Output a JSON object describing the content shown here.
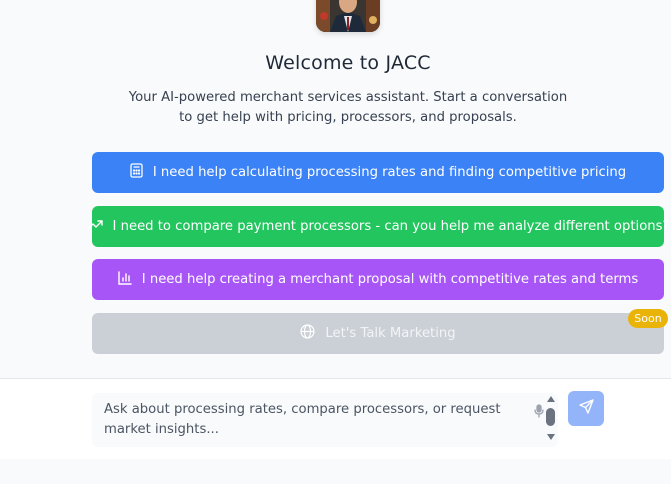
{
  "header": {
    "title": "Welcome to JACC",
    "subtitle": "Your AI-powered merchant services assistant. Start a conversation to get help with pricing, processors, and proposals."
  },
  "actions": [
    {
      "label": "I need help calculating processing rates and finding competitive pricing",
      "icon": "calculator-icon",
      "color": "#3b82f6"
    },
    {
      "label": "I need to compare payment processors - can you help me analyze different options?",
      "icon": "trending-up-icon",
      "color": "#22c55e"
    },
    {
      "label": "I need help creating a merchant proposal with competitive rates and terms",
      "icon": "bar-chart-icon",
      "color": "#a855f7"
    },
    {
      "label": "Let's Talk Marketing",
      "icon": "globe-icon",
      "color": "#cbd0d7",
      "disabled": true
    }
  ],
  "badge": {
    "label": "Soon",
    "color": "#eab308"
  },
  "composer": {
    "placeholder": "Ask about processing rates, compare processors, or request market insights...",
    "send_icon": "send-icon",
    "mic_icon": "mic-icon"
  }
}
